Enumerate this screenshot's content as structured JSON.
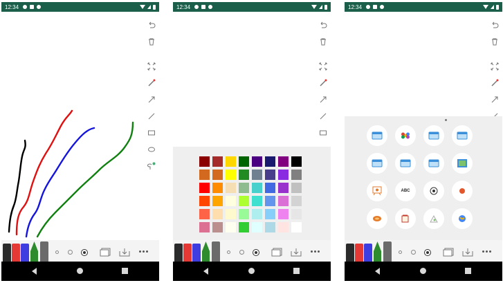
{
  "status_bar": {
    "time": "12:34"
  },
  "colors": {
    "status_bar": "#1b5e49",
    "panel_bg": "#efefef",
    "navbar": "#000000",
    "stroke_black": "#000000",
    "stroke_red": "#e01010",
    "stroke_blue": "#1414dc",
    "stroke_green": "#108010"
  },
  "toolbar_icons": [
    "undo-icon",
    "trash-icon",
    "fit-screen-icon",
    "laser-pointer-icon",
    "arrow-icon",
    "line-icon",
    "rectangle-icon",
    "ellipse-icon",
    "lasso-icon"
  ],
  "pens": [
    {
      "name": "black-pen",
      "color": "#2b2b2b"
    },
    {
      "name": "red-pen",
      "color": "#e53935"
    },
    {
      "name": "blue-pen",
      "color": "#3d3de0"
    },
    {
      "name": "green-highlighter",
      "color": "#2e8b2e"
    },
    {
      "name": "gray-marker",
      "color": "#6b6b6b"
    }
  ],
  "stroke_sizes": [
    "small",
    "medium",
    "large"
  ],
  "palette": [
    "#8b0000",
    "#a52a2a",
    "#ffd700",
    "#006400",
    "#4b0082",
    "#191970",
    "#800080",
    "#000000",
    "#d2691e",
    "#d2691e",
    "#ffff00",
    "#228b22",
    "#708090",
    "#483d8b",
    "#8a2be2",
    "#808080",
    "#ff0000",
    "#ff8c00",
    "#f5deb3",
    "#8fbc8f",
    "#48d1cc",
    "#4169e1",
    "#9932cc",
    "#c0c0c0",
    "#ff4500",
    "#ffa500",
    "#ffffe0",
    "#adff2f",
    "#40e0d0",
    "#6495ed",
    "#da70d6",
    "#d3d3d3",
    "#ff6347",
    "#ffdead",
    "#fffacd",
    "#98fb98",
    "#afeeee",
    "#87cefa",
    "#ee82ee",
    "#e6e6e6",
    "#db7093",
    "#bc8f8f",
    "#fffff0",
    "#32cd32",
    "#e0ffff",
    "#add8e6",
    "#ffe4e1",
    "#ffffff"
  ],
  "stamps": [
    "window-stamp-icon",
    "photo-app-stamp-icon",
    "window-stamp-icon",
    "window-stamp-icon",
    "window-stamp-icon",
    "window-stamp-icon",
    "window-stamp-icon",
    "gallery-stamp-icon",
    "easel-stamp-icon",
    "abc-stamp-icon",
    "soccer-ball-stamp-icon",
    "basketball-stamp-icon",
    "bread-stamp-icon",
    "cup-stamp-icon",
    "paper-stamp-icon",
    "globe-stamp-icon"
  ],
  "stamp_labels": {
    "abc": "ABC"
  }
}
